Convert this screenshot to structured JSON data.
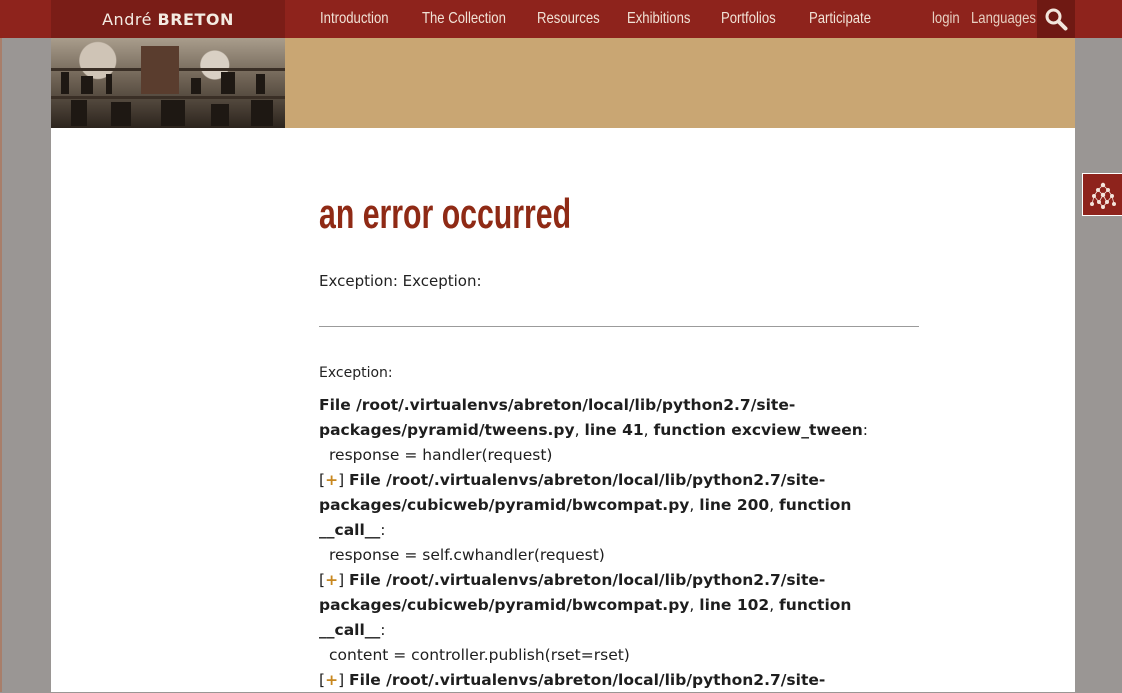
{
  "brand": {
    "first": "André",
    "last": "BRETON"
  },
  "nav": {
    "items": [
      "Introduction",
      "The Collection",
      "Resources",
      "Exhibitions",
      "Portfolios",
      "Participate"
    ],
    "login": "login",
    "languages": "Languages"
  },
  "icons": {
    "search": "search-icon",
    "widget": "network-graph-icon"
  },
  "colors": {
    "topbar": "#8e231c",
    "banner_tan": "#c9a673",
    "title": "#8f2a15",
    "plus": "#c8871f"
  },
  "error": {
    "title": "an error occurred",
    "summary": "Exception: Exception:",
    "traceback_heading": "Exception:",
    "frames": [
      {
        "prefix": "File ",
        "path": "/root/.virtualenvs/abreton/local/lib/python2.7/site-packages/pyramid/tweens.py",
        "line": "line 41",
        "func": "function excview_tween",
        "code": "response = handler(request)"
      },
      {
        "expander": "+",
        "prefix": "File ",
        "path": "/root/.virtualenvs/abreton/local/lib/python2.7/site-packages/cubicweb/pyramid/bwcompat.py",
        "line": "line 200",
        "func": "function __call__",
        "code": "response = self.cwhandler(request)"
      },
      {
        "expander": "+",
        "prefix": "File ",
        "path": "/root/.virtualenvs/abreton/local/lib/python2.7/site-packages/cubicweb/pyramid/bwcompat.py",
        "line": "line 102",
        "func": "function __call__",
        "code": "content = controller.publish(rset=rset)"
      },
      {
        "expander": "+",
        "prefix": "File ",
        "path": "/root/.virtualenvs/abreton/local/lib/python2.7/site-"
      }
    ]
  }
}
